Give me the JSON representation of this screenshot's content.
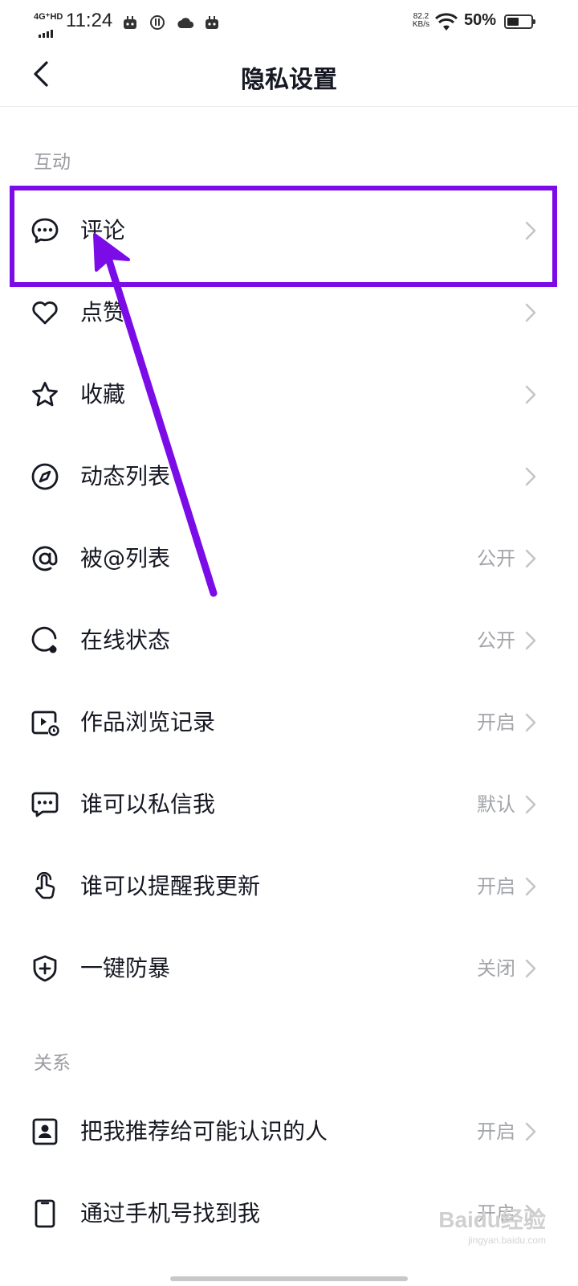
{
  "status_bar": {
    "network": "4G⁺HD",
    "time": "11:24",
    "speed_value": "82.2",
    "speed_unit": "KB/s",
    "battery_text": "50%",
    "battery_level": 0.5
  },
  "header": {
    "title": "隐私设置"
  },
  "sections": [
    {
      "title": "互动",
      "items": [
        {
          "label": "评论",
          "value": "",
          "icon": "comment-icon"
        },
        {
          "label": "点赞",
          "value": "",
          "icon": "heart-icon"
        },
        {
          "label": "收藏",
          "value": "",
          "icon": "star-icon"
        },
        {
          "label": "动态列表",
          "value": "",
          "icon": "compass-icon"
        },
        {
          "label": "被@列表",
          "value": "公开",
          "icon": "at-icon"
        },
        {
          "label": "在线状态",
          "value": "公开",
          "icon": "online-status-icon"
        },
        {
          "label": "作品浏览记录",
          "value": "开启",
          "icon": "video-history-icon"
        },
        {
          "label": "谁可以私信我",
          "value": "默认",
          "icon": "message-icon"
        },
        {
          "label": "谁可以提醒我更新",
          "value": "开启",
          "icon": "pointer-hand-icon"
        },
        {
          "label": "一键防暴",
          "value": "关闭",
          "icon": "shield-plus-icon"
        }
      ]
    },
    {
      "title": "关系",
      "items": [
        {
          "label": "把我推荐给可能认识的人",
          "value": "开启",
          "icon": "contact-card-icon"
        },
        {
          "label": "通过手机号找到我",
          "value": "开启",
          "icon": "phone-icon"
        }
      ]
    }
  ],
  "watermark": {
    "brand": "Baidu经验",
    "url": "jingyan.baidu.com"
  },
  "colors": {
    "annotation": "#7b0ce8",
    "text_primary": "#161823",
    "text_secondary": "#a3a4a9",
    "section_title": "#999aa0"
  }
}
